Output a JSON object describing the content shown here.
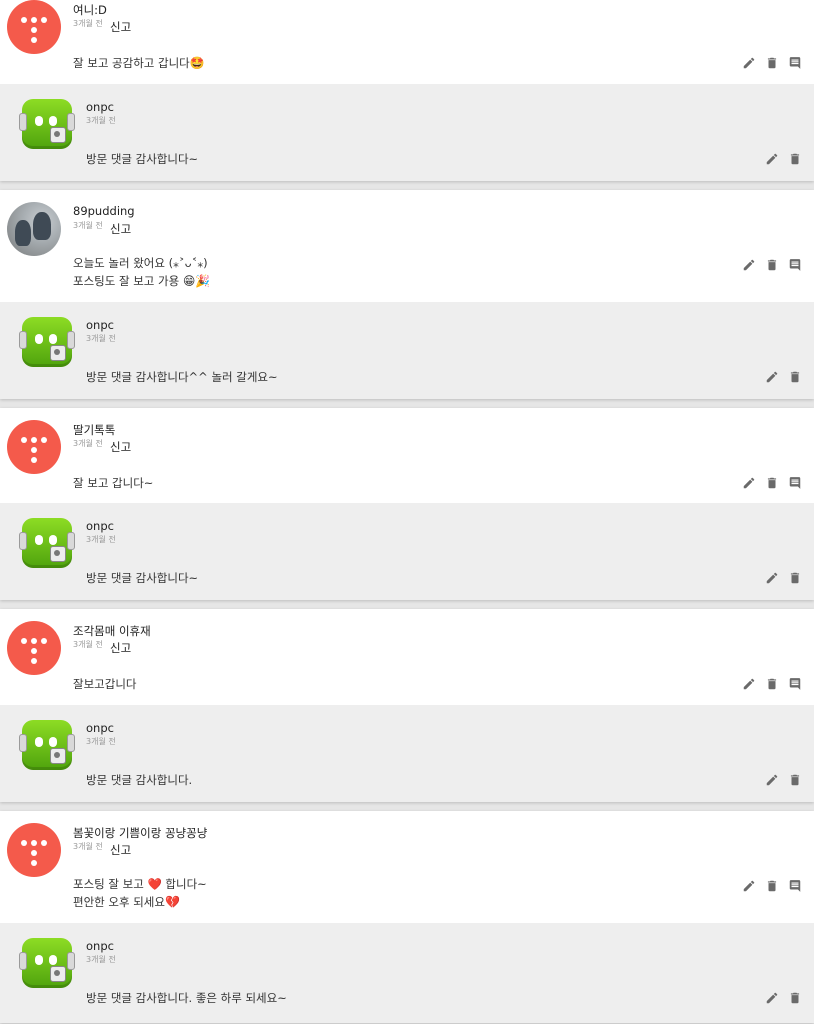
{
  "report_label": "신고",
  "threads": [
    {
      "comment": {
        "author": "여니:D",
        "time": "3개월 전",
        "lines": [
          "잘 보고 공감하고 갑니다"
        ],
        "emoji": [
          "🤩"
        ],
        "avatar": "t"
      },
      "reply": {
        "author": "onpc",
        "time": "3개월 전",
        "text": "방문 댓글 감사합니다~"
      }
    },
    {
      "comment": {
        "author": "89pudding",
        "time": "3개월 전",
        "lines": [
          "오늘도 놀러 왔어요 (⁎˃ᴗ˂⁎)",
          "포스팅도 잘 보고 가용"
        ],
        "emoji": [
          "",
          "😁🎉"
        ],
        "avatar": "photo"
      },
      "reply": {
        "author": "onpc",
        "time": "3개월 전",
        "text": "방문 댓글 감사합니다^^ 놀러 갈게요~"
      }
    },
    {
      "comment": {
        "author": "딸기톡톡",
        "time": "3개월 전",
        "lines": [
          "잘 보고 갑니다~"
        ],
        "emoji": [
          ""
        ],
        "avatar": "t"
      },
      "reply": {
        "author": "onpc",
        "time": "3개월 전",
        "text": "방문 댓글 감사합니다~"
      }
    },
    {
      "comment": {
        "author": "조각몸매 이휴재",
        "time": "3개월 전",
        "lines": [
          "잘보고갑니다"
        ],
        "emoji": [
          ""
        ],
        "avatar": "t"
      },
      "reply": {
        "author": "onpc",
        "time": "3개월 전",
        "text": "방문 댓글 감사합니다."
      }
    },
    {
      "comment": {
        "author": "봄꽃이랑 기쁨이랑 꽁냥꽁냥",
        "time": "3개월 전",
        "lines": [
          "포스팅 잘 보고 ❤️ 합니다~",
          "편안한 오후 되세요"
        ],
        "emoji": [
          "",
          "💔"
        ],
        "avatar": "t"
      },
      "reply": {
        "author": "onpc",
        "time": "3개월 전",
        "text": "방문 댓글 감사합니다. 좋은 하루 되세요~"
      }
    }
  ],
  "icons": {
    "edit": "pencil-icon",
    "delete": "trash-icon",
    "reply": "comment-icon"
  },
  "colors": {
    "avatar_red": "#f45a4b",
    "avatar_green": "#6cc21a",
    "reply_bg": "#eeeeee",
    "icon": "#6a6a6a"
  }
}
